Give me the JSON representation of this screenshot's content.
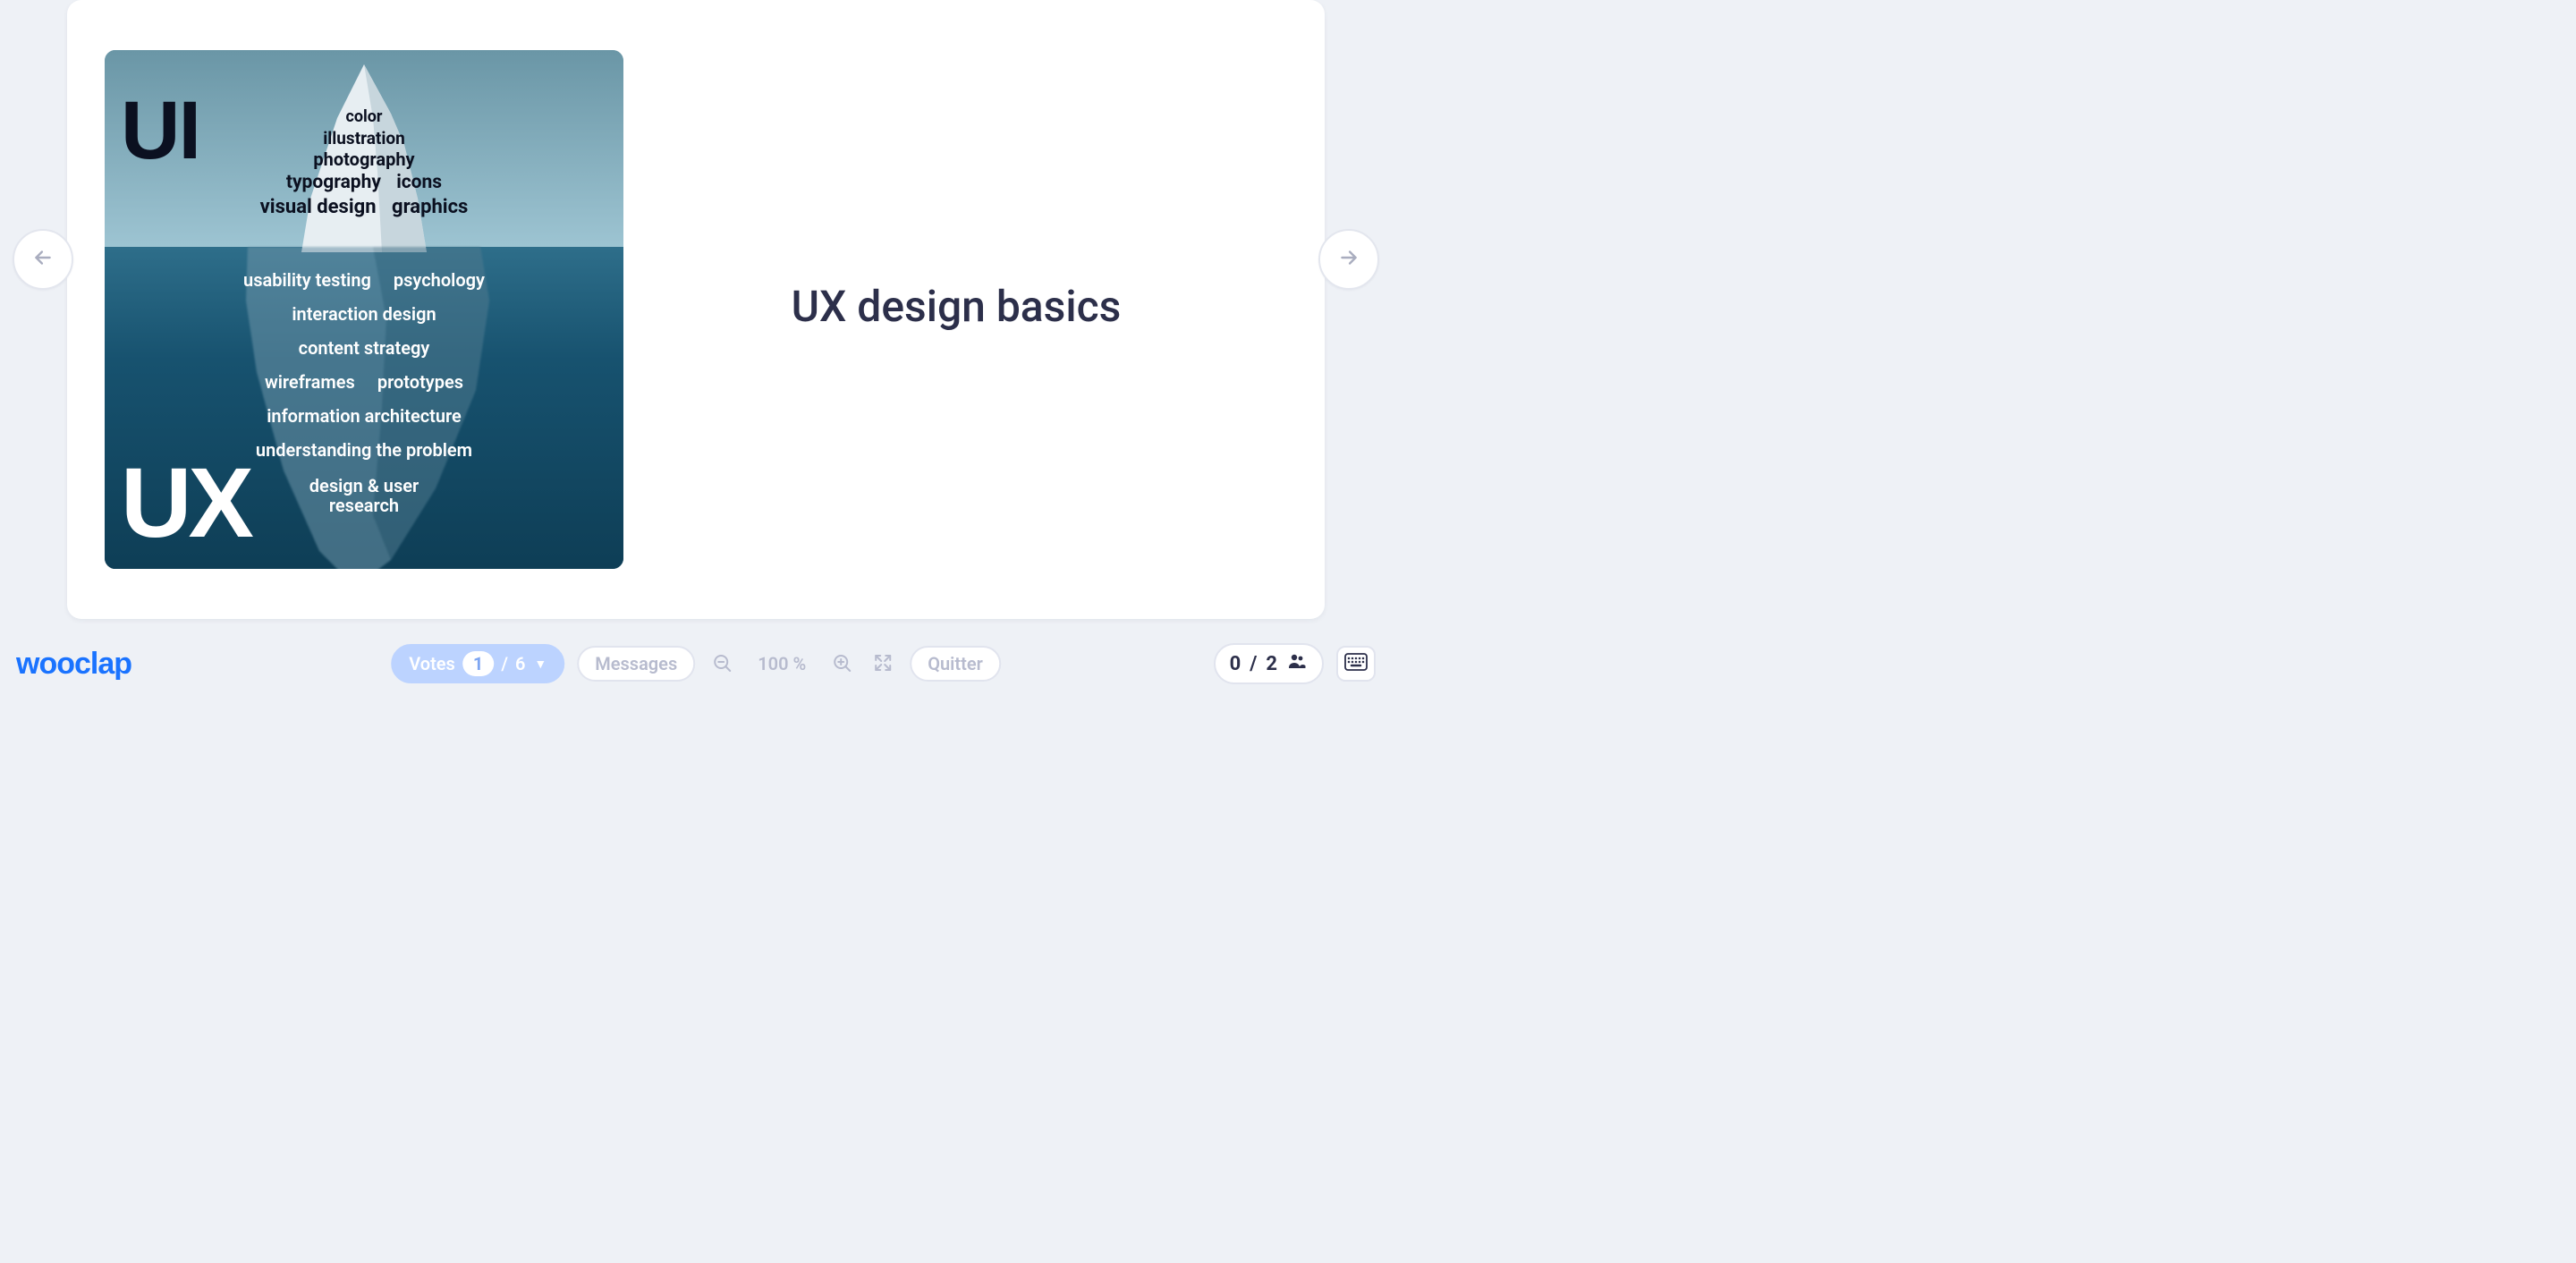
{
  "brand": "wooclap",
  "slide": {
    "title": "UX design basics",
    "illustration": {
      "top_label": "UI",
      "bottom_label": "UX",
      "above_water": {
        "r1": [
          "color"
        ],
        "r2": [
          "illustration"
        ],
        "r3": [
          "photography"
        ],
        "r4": [
          "typography",
          "icons"
        ],
        "r5": [
          "visual design",
          "graphics"
        ]
      },
      "below_water": {
        "r1": [
          "usability testing",
          "psychology"
        ],
        "r2": [
          "interaction design"
        ],
        "r3": [
          "content strategy"
        ],
        "r4": [
          "wireframes",
          "prototypes"
        ],
        "r5": [
          "information architecture"
        ],
        "r6": [
          "understanding the problem"
        ],
        "r7a": "design & user",
        "r7b": "research"
      }
    }
  },
  "toolbar": {
    "votes_label": "Votes",
    "votes_current": "1",
    "votes_sep": "/",
    "votes_total": "6",
    "messages_label": "Messages",
    "zoom_value": "100 %",
    "quit_label": "Quitter"
  },
  "participants": {
    "current": "0",
    "sep": "/",
    "total": "2"
  }
}
